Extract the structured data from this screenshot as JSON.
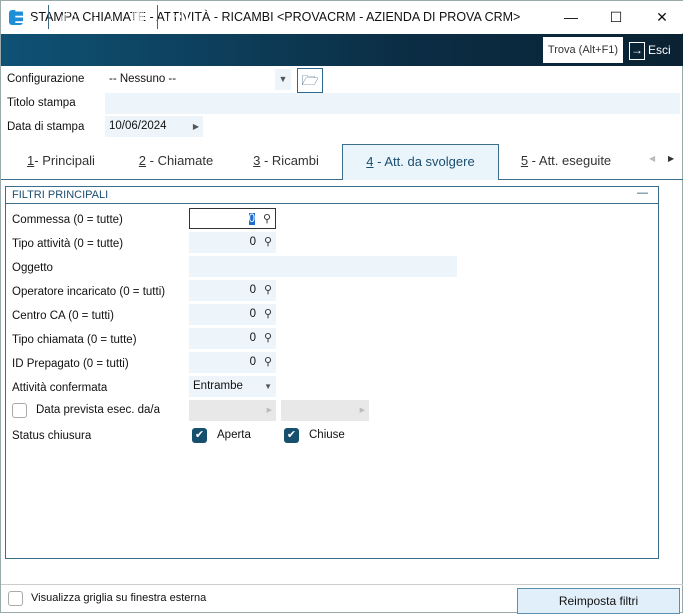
{
  "window": {
    "title": "STAMPA CHIAMATE - ATTIVITÀ - RICAMBI <PROVACRM - AZIENDA DI PROVA CRM>",
    "minimize": "—",
    "maximize": "☐",
    "close": "✕"
  },
  "toolbar": {
    "search_label": "Trova (Alt+F1)",
    "exit_label": "Esci"
  },
  "header": {
    "config_label": "Configurazione",
    "config_value": "-- Nessuno --",
    "title_label": "Titolo stampa",
    "title_value": "",
    "date_label": "Data di stampa",
    "date_value": "10/06/2024"
  },
  "tabs": [
    {
      "num": "1",
      "label": "- Principali"
    },
    {
      "num": "2",
      "label": " - Chiamate"
    },
    {
      "num": "3",
      "label": " - Ricambi"
    },
    {
      "num": "4",
      "label": " - Att. da svolgere"
    },
    {
      "num": "5",
      "label": " - Att. eseguite"
    }
  ],
  "panel": {
    "title": "FILTRI PRINCIPALI",
    "collapse": "—",
    "commessa": {
      "label": "Commessa (0 = tutte)",
      "value": "0"
    },
    "tipo_attivita": {
      "label": "Tipo attività (0 = tutte)",
      "value": "0"
    },
    "oggetto": {
      "label": "Oggetto",
      "value": ""
    },
    "operatore": {
      "label": "Operatore incaricato (0 = tutti)",
      "value": "0"
    },
    "centro_ca": {
      "label": "Centro CA (0 = tutti)",
      "value": "0"
    },
    "tipo_chiamata": {
      "label": "Tipo chiamata (0 = tutte)",
      "value": "0"
    },
    "id_prepagato": {
      "label": "ID Prepagato (0 = tutti)",
      "value": "0"
    },
    "confermata": {
      "label": "Attività confermata",
      "value": "Entrambe"
    },
    "data_prevista": {
      "label": "Data prevista esec. da/a",
      "checked": false
    },
    "status": {
      "label": "Status chiusura",
      "aperta": "Aperta",
      "chiuse": "Chiuse",
      "aperta_checked": true,
      "chiuse_checked": true
    }
  },
  "footer": {
    "external_grid_label": "Visualizza griglia su finestra esterna",
    "reset_button": "Reimposta filtri"
  }
}
